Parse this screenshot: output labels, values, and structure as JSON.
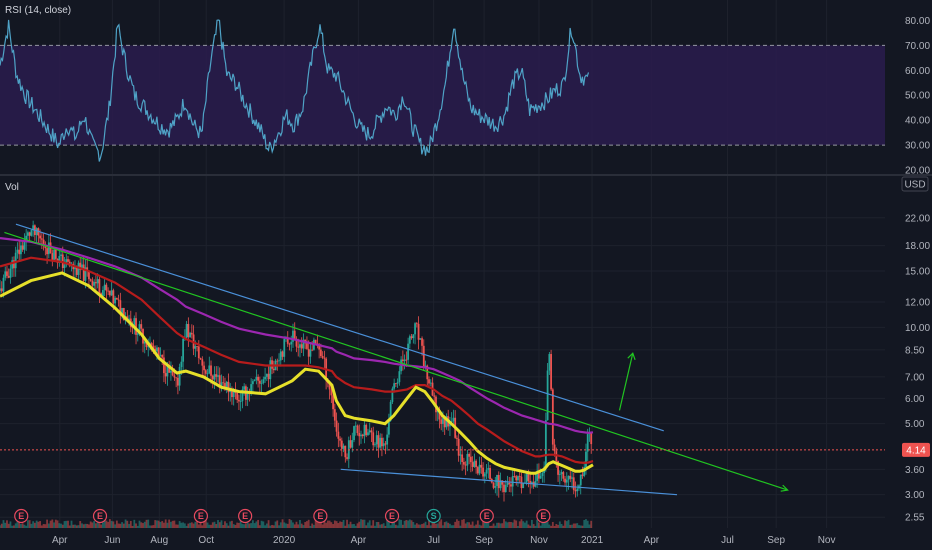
{
  "colors": {
    "background": "#131722",
    "rsi_band": "#2a1c4e",
    "rsi_line": "#4fa3c7",
    "up_candle": "#26a69a",
    "down_candle": "#ef5350",
    "trend_blue": "#4a90d9",
    "trend_green": "#21c521",
    "ma_yellow": "#e6e02a",
    "ma_red": "#b71c1c",
    "ma_purple": "#9c27b0",
    "price_tag": "#ef5350",
    "earnings_badge": "#e84a5f",
    "split_badge": "#26a69a"
  },
  "chart_data": {
    "type": "line",
    "rsi_panel": {
      "legend": "RSI (14, close)",
      "y_ticks": [
        "80.00",
        "70.00",
        "60.00",
        "50.00",
        "40.00",
        "30.00",
        "20.00"
      ],
      "ylim": [
        20,
        85
      ],
      "overbought": 70,
      "oversold": 30,
      "series": {
        "x": [
          0,
          0.01,
          0.018,
          0.03,
          0.05,
          0.07,
          0.09,
          0.11,
          0.13,
          0.15,
          0.17,
          0.18,
          0.19,
          0.2,
          0.205,
          0.21,
          0.22,
          0.235,
          0.25,
          0.27,
          0.29,
          0.31,
          0.33,
          0.335,
          0.34,
          0.35,
          0.37,
          0.385,
          0.39,
          0.4,
          0.42,
          0.44,
          0.45,
          0.46,
          0.47,
          0.48,
          0.49,
          0.51,
          0.53,
          0.55,
          0.56,
          0.57,
          0.58,
          0.59,
          0.6,
          0.61,
          0.62,
          0.63,
          0.64,
          0.65,
          0.66,
          0.68,
          0.7,
          0.72,
          0.74,
          0.76,
          0.78,
          0.8,
          0.82,
          0.83,
          0.84,
          0.85,
          0.86,
          0.87,
          0.88,
          0.89,
          0.9,
          0.91,
          0.92,
          0.93,
          0.94,
          0.95,
          0.96,
          0.965,
          0.97,
          0.98,
          0.99,
          1.0
        ],
        "values": [
          62,
          78,
          58,
          50,
          45,
          40,
          35,
          30,
          38,
          33,
          42,
          30,
          26,
          45,
          78,
          62,
          50,
          46,
          42,
          38,
          36,
          40,
          48,
          38,
          34,
          62,
          80,
          58,
          55,
          48,
          42,
          36,
          28,
          34,
          42,
          38,
          45,
          62,
          78,
          60,
          58,
          50,
          42,
          36,
          34,
          40,
          46,
          42,
          50,
          38,
          30,
          28,
          40,
          55,
          80,
          58,
          45,
          42,
          40,
          38,
          42,
          55,
          60,
          44,
          46,
          48,
          52,
          54,
          78,
          58,
          56
        ],
        "values_note_dummy": null
      }
    },
    "price_panel": {
      "legend": "Vol",
      "y_axis_unit": "USD",
      "y_scale": "log",
      "y_ticks": [
        "22.00",
        "18.00",
        "15.00",
        "12.00",
        "10.00",
        "8.50",
        "7.00",
        "6.00",
        "5.00",
        "4.14",
        "3.60",
        "3.00",
        "2.55"
      ],
      "ylim": [
        2.5,
        25
      ],
      "last_price": "4.14",
      "x_ticks": [
        "Apr",
        "Jun",
        "Aug",
        "Oct",
        "2020",
        "Apr",
        "Jul",
        "Sep",
        "Nov",
        "2021",
        "Apr",
        "Jul",
        "Sep",
        "Nov"
      ],
      "x_tick_fracs": [
        0.0675,
        0.127,
        0.18,
        0.233,
        0.321,
        0.405,
        0.49,
        0.547,
        0.609,
        0.669,
        0.736,
        0.822,
        0.877,
        0.934
      ],
      "date_fracs": [
        0.0,
        0.035,
        0.07,
        0.1,
        0.13,
        0.16,
        0.18,
        0.2,
        0.21,
        0.23,
        0.25,
        0.27,
        0.3,
        0.33,
        0.345,
        0.36,
        0.375,
        0.38,
        0.39,
        0.4,
        0.42,
        0.435,
        0.445,
        0.46,
        0.47,
        0.48,
        0.49,
        0.5,
        0.51,
        0.52,
        0.53,
        0.54,
        0.55,
        0.56,
        0.57,
        0.58,
        0.59,
        0.6,
        0.605,
        0.61,
        0.615,
        0.62,
        0.625,
        0.63,
        0.635,
        0.64,
        0.645,
        0.65,
        0.655,
        0.66,
        0.665,
        0.67
      ],
      "close": [
        13.0,
        20.0,
        16.0,
        14.5,
        12.0,
        9.5,
        8.0,
        6.5,
        10.0,
        7.5,
        6.8,
        6.0,
        7.0,
        9.5,
        8.5,
        8.8,
        6.0,
        4.8,
        3.9,
        4.8,
        4.6,
        4.2,
        6.5,
        8.5,
        10.0,
        7.5,
        5.8,
        5.0,
        5.3,
        4.0,
        3.8,
        3.6,
        3.5,
        3.3,
        3.2,
        3.3,
        3.2,
        3.4,
        3.3,
        3.5,
        3.6,
        8.5,
        4.3,
        3.5,
        3.4,
        3.3,
        3.3,
        3.2,
        3.4,
        3.7,
        4.8,
        4.1
      ],
      "ma_yellow": [
        12.5,
        14.0,
        14.8,
        13.5,
        11.5,
        9.5,
        8.0,
        7.2,
        7.3,
        7.0,
        6.5,
        6.3,
        6.2,
        6.8,
        7.4,
        7.3,
        6.6,
        5.9,
        5.3,
        5.2,
        5.1,
        5.0,
        5.3,
        6.0,
        6.5,
        6.3,
        5.8,
        5.3,
        5.0,
        4.7,
        4.4,
        4.1,
        3.9,
        3.75,
        3.65,
        3.6,
        3.55,
        3.5,
        3.5,
        3.55,
        3.6,
        3.75,
        3.8,
        3.75,
        3.7,
        3.65,
        3.6,
        3.55,
        3.55,
        3.58,
        3.65,
        3.72
      ],
      "ma_red": [
        15.5,
        16.5,
        16.0,
        15.0,
        13.8,
        12.2,
        10.8,
        9.6,
        9.2,
        8.7,
        8.2,
        7.8,
        7.6,
        7.6,
        7.6,
        7.5,
        7.3,
        7.0,
        6.7,
        6.5,
        6.4,
        6.3,
        6.3,
        6.4,
        6.6,
        6.6,
        6.4,
        6.1,
        5.9,
        5.6,
        5.3,
        5.0,
        4.8,
        4.6,
        4.4,
        4.25,
        4.1,
        4.0,
        3.95,
        3.95,
        3.98,
        4.0,
        4.0,
        3.98,
        3.95,
        3.9,
        3.85,
        3.8,
        3.78,
        3.77,
        3.78,
        3.82
      ],
      "ma_purple": [
        19.0,
        18.5,
        17.5,
        16.5,
        15.5,
        14.3,
        13.2,
        12.2,
        11.6,
        11.0,
        10.4,
        9.9,
        9.5,
        9.2,
        9.0,
        8.8,
        8.6,
        8.4,
        8.2,
        8.0,
        7.9,
        7.8,
        7.7,
        7.6,
        7.55,
        7.5,
        7.4,
        7.2,
        7.0,
        6.8,
        6.5,
        6.25,
        6.0,
        5.8,
        5.6,
        5.45,
        5.3,
        5.2,
        5.15,
        5.1,
        5.05,
        5.0,
        4.98,
        4.95,
        4.9,
        4.85,
        4.8,
        4.75,
        4.72,
        4.7,
        4.68,
        4.7
      ],
      "trend_lines": [
        {
          "name": "upper",
          "x": [
            0.018,
            0.75
          ],
          "y": [
            21.0,
            4.75
          ]
        },
        {
          "name": "green",
          "x": [
            0.005,
            0.89
          ],
          "y": [
            19.8,
            3.1
          ]
        },
        {
          "name": "lower",
          "x": [
            0.385,
            0.765
          ],
          "y": [
            3.6,
            3.0
          ]
        }
      ],
      "projection_arrow": {
        "x": [
          0.7,
          0.715
        ],
        "y": [
          5.5,
          8.3
        ]
      },
      "events": [
        {
          "label": "E",
          "x": 0.024
        },
        {
          "label": "E",
          "x": 0.113
        },
        {
          "label": "E",
          "x": 0.227
        },
        {
          "label": "E",
          "x": 0.277
        },
        {
          "label": "E",
          "x": 0.362
        },
        {
          "label": "E",
          "x": 0.443
        },
        {
          "label": "S",
          "x": 0.49
        },
        {
          "label": "E",
          "x": 0.55
        },
        {
          "label": "E",
          "x": 0.614
        }
      ]
    }
  }
}
